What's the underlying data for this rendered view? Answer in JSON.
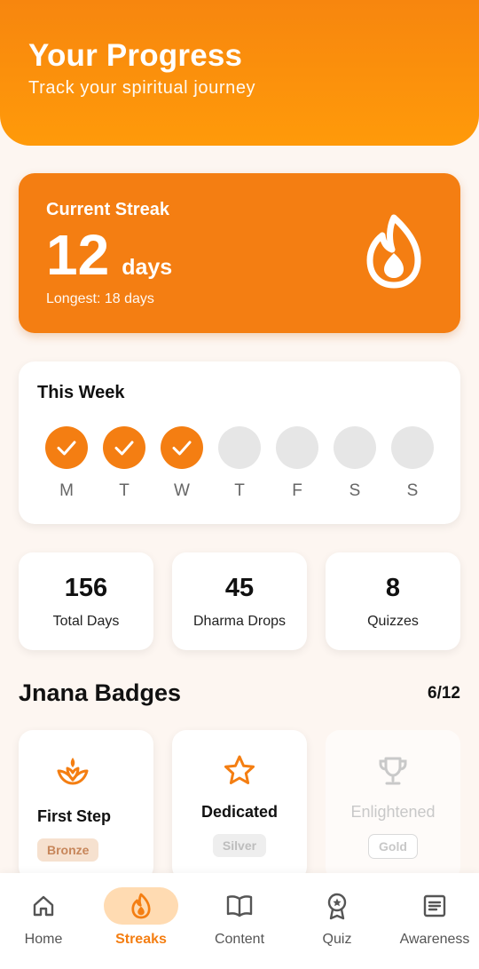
{
  "header": {
    "title": "Your Progress",
    "subtitle": "Track your spiritual journey"
  },
  "streak": {
    "label": "Current Streak",
    "count": "12",
    "unit": "days",
    "longest": "Longest: 18 days",
    "icon": "flame-icon"
  },
  "week": {
    "title": "This Week",
    "days": [
      {
        "label": "M",
        "done": true
      },
      {
        "label": "T",
        "done": true
      },
      {
        "label": "W",
        "done": true
      },
      {
        "label": "T",
        "done": false
      },
      {
        "label": "F",
        "done": false
      },
      {
        "label": "S",
        "done": false
      },
      {
        "label": "S",
        "done": false
      }
    ]
  },
  "stats": [
    {
      "value": "156",
      "label": "Total Days"
    },
    {
      "value": "45",
      "label": "Dharma Drops"
    },
    {
      "value": "8",
      "label": "Quizzes"
    }
  ],
  "badges": {
    "title": "Jnana Badges",
    "count": "6/12",
    "items": [
      {
        "name": "First Step",
        "tier": "Bronze",
        "icon": "lotus-icon",
        "unlocked": true
      },
      {
        "name": "Dedicated",
        "tier": "Silver",
        "icon": "star-icon",
        "unlocked": true
      },
      {
        "name": "Enlightened",
        "tier": "Gold",
        "icon": "trophy-icon",
        "unlocked": false
      }
    ]
  },
  "nav": {
    "items": [
      {
        "label": "Home",
        "icon": "home-icon",
        "active": false
      },
      {
        "label": "Streaks",
        "icon": "flame-icon",
        "active": true
      },
      {
        "label": "Content",
        "icon": "book-icon",
        "active": false
      },
      {
        "label": "Quiz",
        "icon": "award-icon",
        "active": false
      },
      {
        "label": "Awareness",
        "icon": "article-icon",
        "active": false
      }
    ]
  },
  "colors": {
    "accent": "#F47E12",
    "header": "#F7860E",
    "background": "#FDF6F1",
    "inactive_day": "#E6E6E6"
  }
}
